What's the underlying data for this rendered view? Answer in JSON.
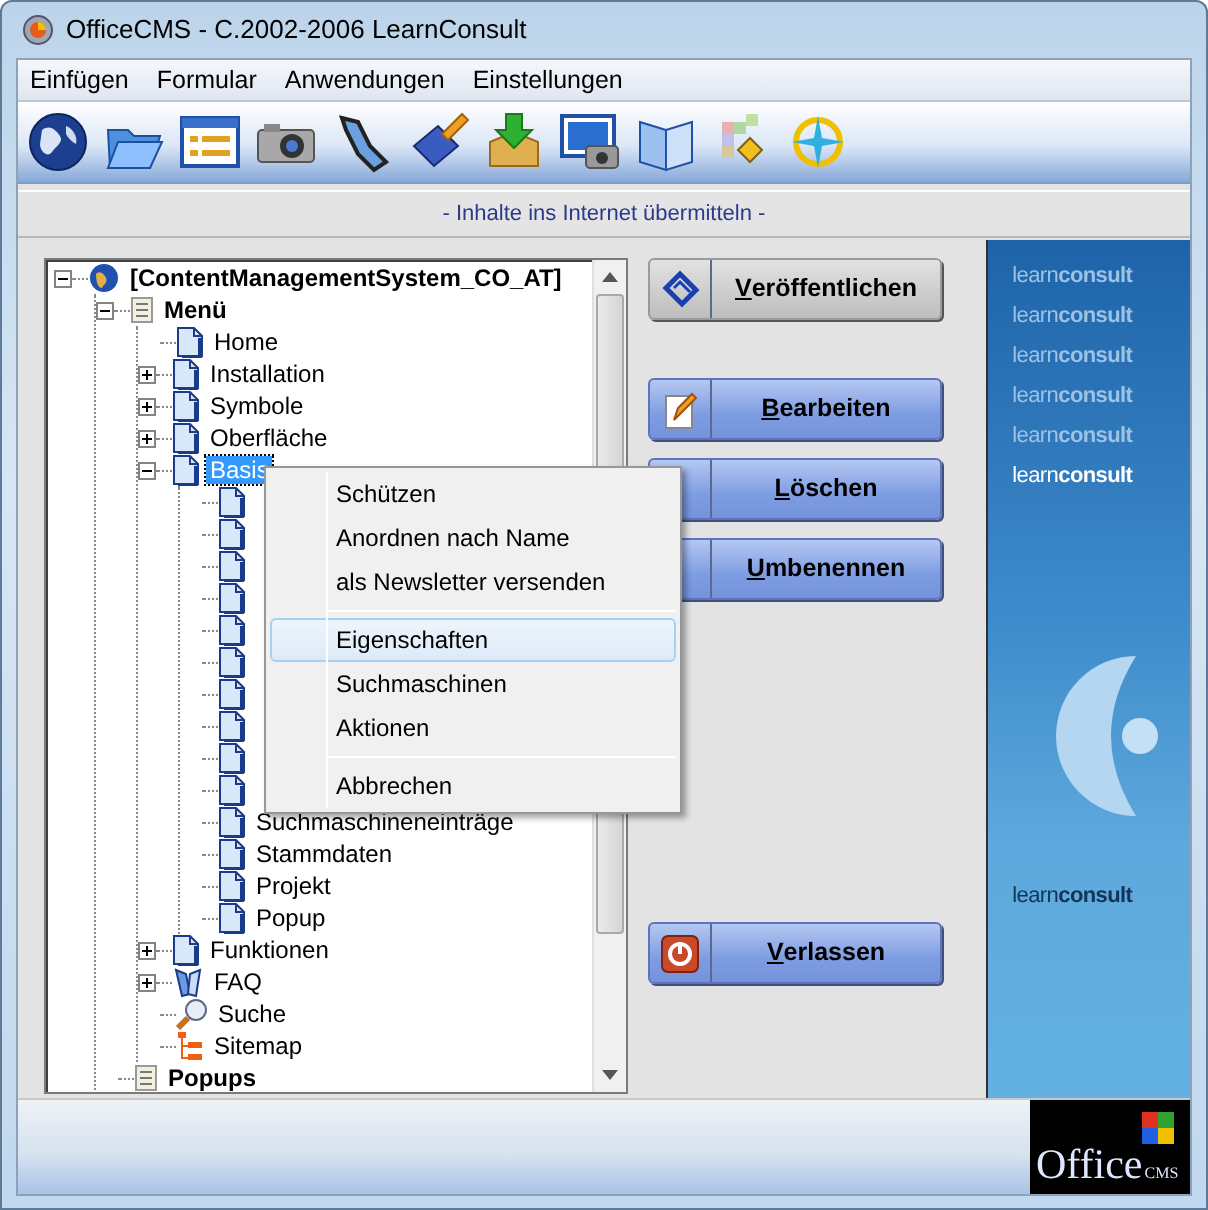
{
  "window": {
    "title": "OfficeCMS - C.2002-2006 LearnConsult"
  },
  "menu_bar": [
    "Einfügen",
    "Formular",
    "Anwendungen",
    "Einstellungen"
  ],
  "subtitle": "- Inhalte ins Internet übermitteln -",
  "tree": {
    "items": [
      {
        "label": "[ContentManagementSystem_CO_AT]",
        "kind": "site",
        "expanded": true,
        "selected": false,
        "children": [
          {
            "label": "Menü",
            "kind": "section",
            "expanded": true,
            "selected": false,
            "children": [
              {
                "label": "Home",
                "kind": "page",
                "selected": false
              },
              {
                "label": "Installation",
                "kind": "page",
                "expanded": false,
                "selected": false
              },
              {
                "label": "Symbole",
                "kind": "page",
                "expanded": false,
                "selected": false
              },
              {
                "label": "Oberfläche",
                "kind": "page",
                "expanded": false,
                "selected": false
              },
              {
                "label": "Basis",
                "kind": "page",
                "expanded": true,
                "selected": true,
                "children": [
                  {
                    "kind": "page"
                  },
                  {
                    "kind": "page"
                  },
                  {
                    "kind": "page"
                  },
                  {
                    "kind": "page"
                  },
                  {
                    "kind": "page"
                  },
                  {
                    "kind": "page"
                  },
                  {
                    "kind": "page"
                  },
                  {
                    "kind": "page"
                  },
                  {
                    "kind": "page"
                  },
                  {
                    "kind": "page"
                  },
                  {
                    "label": "Suchmaschineneinträge",
                    "kind": "page",
                    "selected": false
                  },
                  {
                    "label": "Stammdaten",
                    "kind": "page",
                    "selected": false
                  },
                  {
                    "label": "Projekt",
                    "kind": "page",
                    "selected": false
                  },
                  {
                    "label": "Popup",
                    "kind": "page",
                    "selected": false
                  }
                ]
              },
              {
                "label": "Funktionen",
                "kind": "page",
                "expanded": false,
                "selected": false
              },
              {
                "label": "FAQ",
                "kind": "faq",
                "expanded": false,
                "selected": false
              },
              {
                "label": "Suche",
                "kind": "search",
                "selected": false
              },
              {
                "label": "Sitemap",
                "kind": "sitemap",
                "selected": false
              }
            ]
          },
          {
            "label": "Popups",
            "kind": "section",
            "selected": false
          }
        ]
      }
    ]
  },
  "context_menu": [
    {
      "label": "Schützen",
      "kind": "item",
      "selected": false
    },
    {
      "label": "Anordnen nach Name",
      "kind": "item",
      "selected": false
    },
    {
      "label": "als Newsletter versenden",
      "kind": "item",
      "selected": false
    },
    {
      "kind": "separator"
    },
    {
      "label": "Eigenschaften",
      "kind": "item",
      "selected": true
    },
    {
      "label": "Suchmaschinen",
      "kind": "item",
      "selected": false
    },
    {
      "label": "Aktionen",
      "kind": "item",
      "selected": false
    },
    {
      "kind": "separator"
    },
    {
      "label": "Abbrechen",
      "kind": "item",
      "selected": false
    }
  ],
  "button_groups": [
    [
      {
        "label": "Veröffentlichen",
        "kind": "gray"
      }
    ],
    [
      {
        "label": "Bearbeiten",
        "kind": "blue"
      },
      {
        "label": "Löschen",
        "kind": "blue"
      },
      {
        "label": "Umbenennen",
        "kind": "blue"
      }
    ],
    [
      {
        "label": "Verlassen",
        "kind": "blue"
      }
    ]
  ],
  "brand_panel": {
    "logos": [
      {
        "text": "learn**consult**",
        "kind": "faded"
      },
      {
        "text": "learn**consult**",
        "kind": "faded"
      },
      {
        "text": "learn**consult**",
        "kind": "faded"
      },
      {
        "text": "learn**consult**",
        "kind": "faded"
      },
      {
        "text": "learn**consult**",
        "kind": "faded"
      },
      {
        "text": "learn**consult**",
        "kind": "bright"
      }
    ],
    "bottom_logo": {
      "text": "learn**consult**",
      "kind": "dark"
    }
  },
  "footer_logo": {
    "word": "Office",
    "suffix": "CMS"
  }
}
